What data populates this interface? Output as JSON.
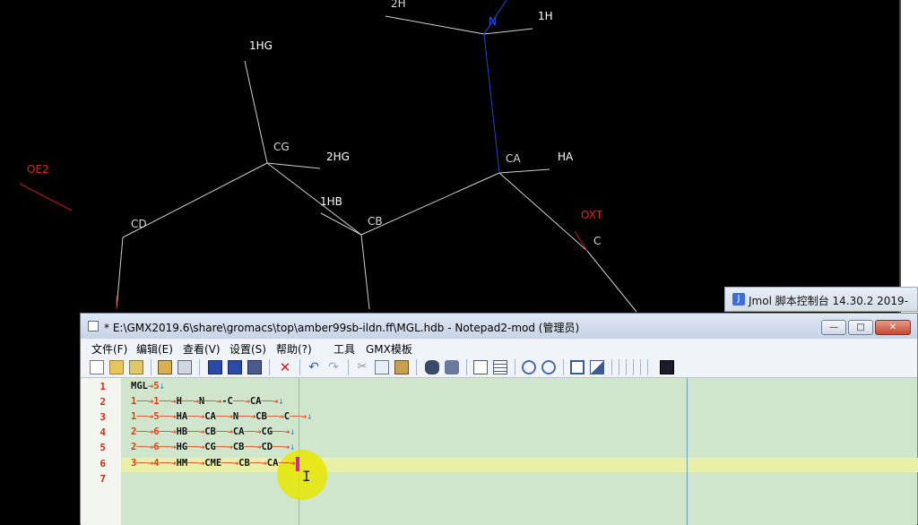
{
  "jmol": {
    "atoms": [
      {
        "label": "2H",
        "color": "white"
      },
      {
        "label": "N",
        "color": "blue"
      },
      {
        "label": "1H",
        "color": "white"
      },
      {
        "label": "1HG",
        "color": "white"
      },
      {
        "label": "CG",
        "color": "grey"
      },
      {
        "label": "2HG",
        "color": "white"
      },
      {
        "label": "CA",
        "color": "grey"
      },
      {
        "label": "HA",
        "color": "white"
      },
      {
        "label": "OE2",
        "color": "red"
      },
      {
        "label": "CD",
        "color": "grey"
      },
      {
        "label": "1HB",
        "color": "white"
      },
      {
        "label": "CB",
        "color": "grey"
      },
      {
        "label": "OXT",
        "color": "red"
      },
      {
        "label": "C",
        "color": "grey"
      }
    ],
    "console_title": "Jmol 脚本控制台 14.30.2  2019-"
  },
  "notepad": {
    "title": "* E:\\GMX2019.6\\share\\gromacs\\top\\amber99sb-ildn.ff\\MGL.hdb - Notepad2-mod (管理员)",
    "window_buttons": {
      "minimize": "—",
      "maximize": "□",
      "close": "✕"
    },
    "menu": [
      "文件(F)",
      "编辑(E)",
      "查看(V)",
      "设置(S)",
      "帮助(?)",
      "工具",
      "GMX模板"
    ],
    "toolbar_icons": [
      "new-file-icon",
      "open-folder-icon",
      "browse-icon",
      "save-icon-a",
      "new-window-icon",
      "save-icon",
      "save-as-icon",
      "save-copy-icon",
      "close-file-icon",
      "undo-icon",
      "redo-icon",
      "cut-icon",
      "copy-icon",
      "paste-icon",
      "find-icon",
      "replace-icon",
      "word-wrap-icon",
      "line-numbers-icon",
      "zoom-in-icon",
      "zoom-out-icon",
      "scheme-icon",
      "customize-icon",
      "terminal-icon"
    ],
    "line_numbers": [
      "1",
      "2",
      "3",
      "4",
      "5",
      "6",
      "7"
    ],
    "lines": [
      [
        "MGL",
        "5"
      ],
      [
        "1",
        "1",
        "H",
        "N",
        "-C",
        "CA"
      ],
      [
        "1",
        "5",
        "HA",
        "CA",
        "N",
        "CB",
        "C"
      ],
      [
        "2",
        "6",
        "HB",
        "CB",
        "CA",
        "CG"
      ],
      [
        "2",
        "6",
        "HG",
        "CG",
        "CB",
        "CD"
      ],
      [
        "3",
        "4",
        "HM",
        "CME",
        "CB",
        "CA"
      ],
      []
    ],
    "current_line": 6
  }
}
